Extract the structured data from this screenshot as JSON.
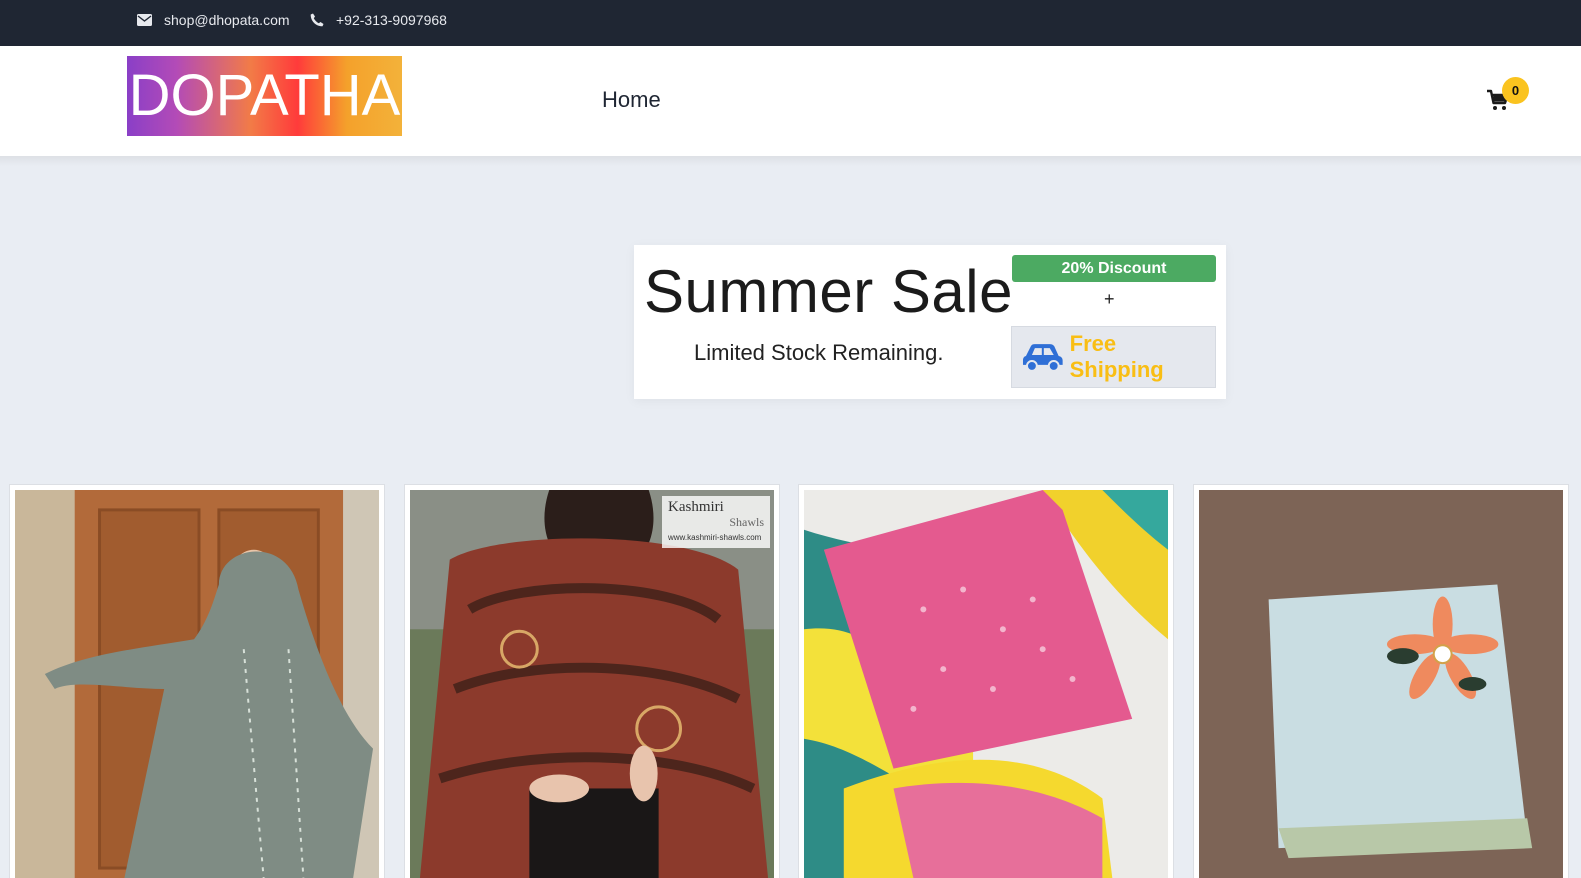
{
  "topbar": {
    "email": "shop@dhopata.com",
    "phone": "+92-313-9097968",
    "email_icon": "envelope-icon",
    "phone_icon": "phone-icon"
  },
  "header": {
    "logo_text": "DOPATHA",
    "nav": [
      {
        "label": "Home"
      }
    ],
    "cart_icon": "shopping-cart-icon",
    "cart_count": "0"
  },
  "promo": {
    "title": "Summer Sale",
    "subtitle": "Limited Stock Remaining.",
    "discount": "20% Discount",
    "plus": "+",
    "shipping": "Free Shipping",
    "shipping_icon": "car-icon"
  },
  "products": [
    {
      "image": "woman in sage green embroidered abaya with dupatta"
    },
    {
      "image": "woman in red paisley kashmiri shawl",
      "watermark": "Kashmiri",
      "watermark_sub": "Shawls",
      "watermark_url": "www.kashmiri-shawls.com"
    },
    {
      "image": "pink chikankari suit with yellow teal tie-dye dupatta"
    },
    {
      "image": "light blue folded dupatta with flower embroidery"
    }
  ],
  "colors": {
    "topbar": "#1f2633",
    "discount": "#4caa62",
    "shipping": "#f9be14",
    "badge": "#fac31f",
    "page_bg": "#e9edf3"
  }
}
